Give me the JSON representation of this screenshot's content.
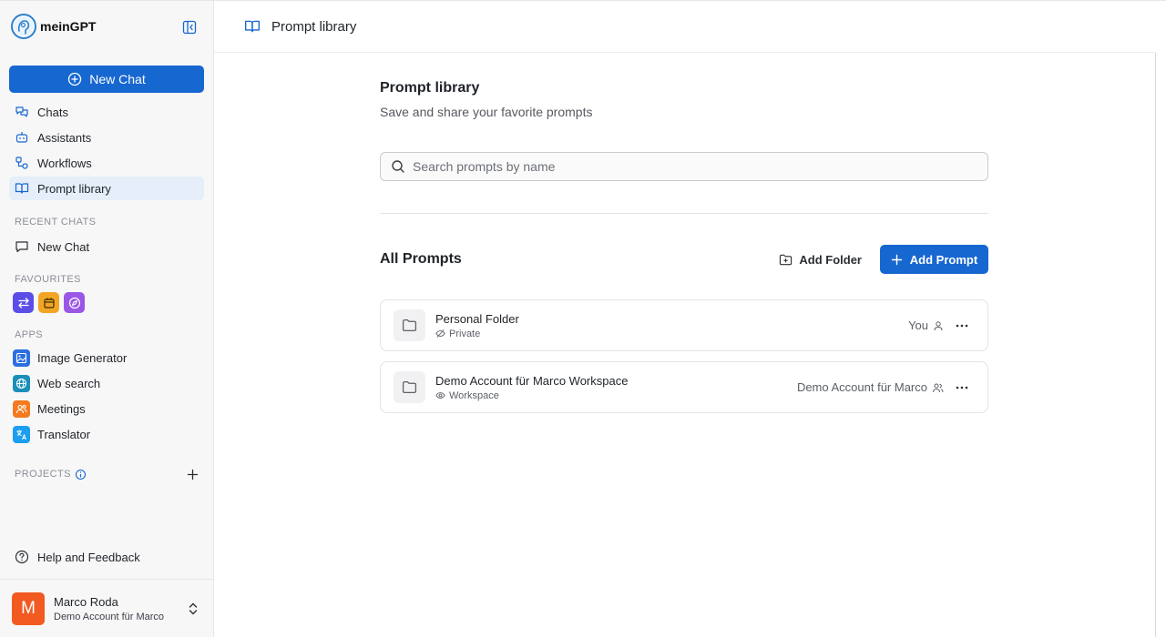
{
  "brand": {
    "name": "meinGPT"
  },
  "sidebar": {
    "new_chat_label": "New Chat",
    "nav": [
      {
        "label": "Chats",
        "icon": "chats-icon"
      },
      {
        "label": "Assistants",
        "icon": "robot-icon"
      },
      {
        "label": "Workflows",
        "icon": "workflow-icon"
      },
      {
        "label": "Prompt library",
        "icon": "book-icon",
        "active": true
      }
    ],
    "recent_label": "RECENT CHATS",
    "recent": [
      {
        "label": "New Chat"
      }
    ],
    "favourites_label": "FAVOURITES",
    "favourites": [
      {
        "icon": "swap-arrows-icon",
        "color": "#5b4ee6"
      },
      {
        "icon": "calendar-icon",
        "color": "#f2a524"
      },
      {
        "icon": "compass-icon",
        "color": "#9a57e6"
      }
    ],
    "apps_label": "APPS",
    "apps": [
      {
        "label": "Image Generator",
        "icon": "image-icon",
        "color": "#2c6fe0"
      },
      {
        "label": "Web search",
        "icon": "globe-icon",
        "color": "#1a8fb8"
      },
      {
        "label": "Meetings",
        "icon": "people-icon",
        "color": "#f57a1f"
      },
      {
        "label": "Translator",
        "icon": "translate-icon",
        "color": "#1b9ef0"
      }
    ],
    "projects_label": "PROJECTS",
    "help_label": "Help and Feedback"
  },
  "user": {
    "initial": "M",
    "name": "Marco Roda",
    "org": "Demo Account für Marco",
    "avatar_color": "#f25a22"
  },
  "header": {
    "title": "Prompt library"
  },
  "main": {
    "title": "Prompt library",
    "subtitle": "Save and share your favorite prompts",
    "search_placeholder": "Search prompts by name",
    "search_value": "",
    "all_prompts_title": "All Prompts",
    "add_folder_label": "Add Folder",
    "add_prompt_label": "Add Prompt",
    "folders": [
      {
        "name": "Personal Folder",
        "visibility": "Private",
        "vis_icon": "eye-off-icon",
        "owner": "You",
        "owner_icon": "user-icon"
      },
      {
        "name": "Demo Account für Marco Workspace",
        "visibility": "Workspace",
        "vis_icon": "eye-icon",
        "owner": "Demo Account für Marco",
        "owner_icon": "users-icon"
      }
    ]
  },
  "colors": {
    "accent": "#1767d0",
    "sidebar_bg": "#f7f7f8",
    "active_bg": "#e5eef9"
  }
}
